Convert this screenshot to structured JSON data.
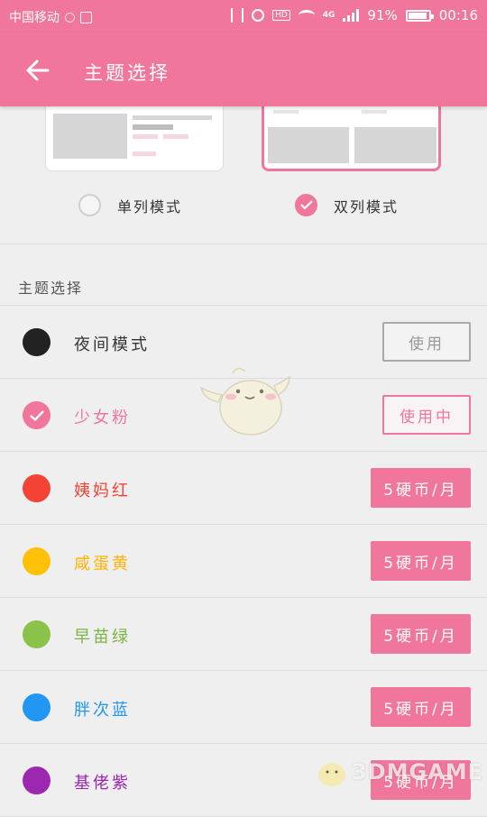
{
  "status_bar": {
    "carrier": "中国移动",
    "network": "4G",
    "battery": "91%",
    "battery_level": 0.91,
    "time": "00:16"
  },
  "app_bar": {
    "title": "主题选择",
    "back_icon": "arrow-left-icon"
  },
  "layout_modes": [
    {
      "label": "单列模式",
      "selected": false
    },
    {
      "label": "双列模式",
      "selected": true
    }
  ],
  "theme_section": {
    "title": "主题选择",
    "themes": [
      {
        "name": "夜间模式",
        "color": "#222222",
        "name_color": "#333333",
        "action": "使用",
        "state": "available"
      },
      {
        "name": "少女粉",
        "color": "#f0769b",
        "name_color": "#f0769b",
        "action": "使用中",
        "state": "in-use"
      },
      {
        "name": "姨妈红",
        "color": "#f44336",
        "name_color": "#f44336",
        "action": "5硬币/月",
        "state": "paid"
      },
      {
        "name": "咸蛋黄",
        "color": "#ffc107",
        "name_color": "#ffb300",
        "action": "5硬币/月",
        "state": "paid"
      },
      {
        "name": "早苗绿",
        "color": "#8bc34a",
        "name_color": "#7cb342",
        "action": "5硬币/月",
        "state": "paid"
      },
      {
        "name": "胖次蓝",
        "color": "#2196f3",
        "name_color": "#2196f3",
        "action": "5硬币/月",
        "state": "paid"
      },
      {
        "name": "基佬紫",
        "color": "#9c27b0",
        "name_color": "#9c27b0",
        "action": "5硬币/月",
        "state": "paid"
      }
    ]
  },
  "watermark": {
    "text": "3DMGAME"
  },
  "colors": {
    "accent": "#f0769b",
    "background": "#efefef",
    "divider": "#dcdcdc"
  }
}
